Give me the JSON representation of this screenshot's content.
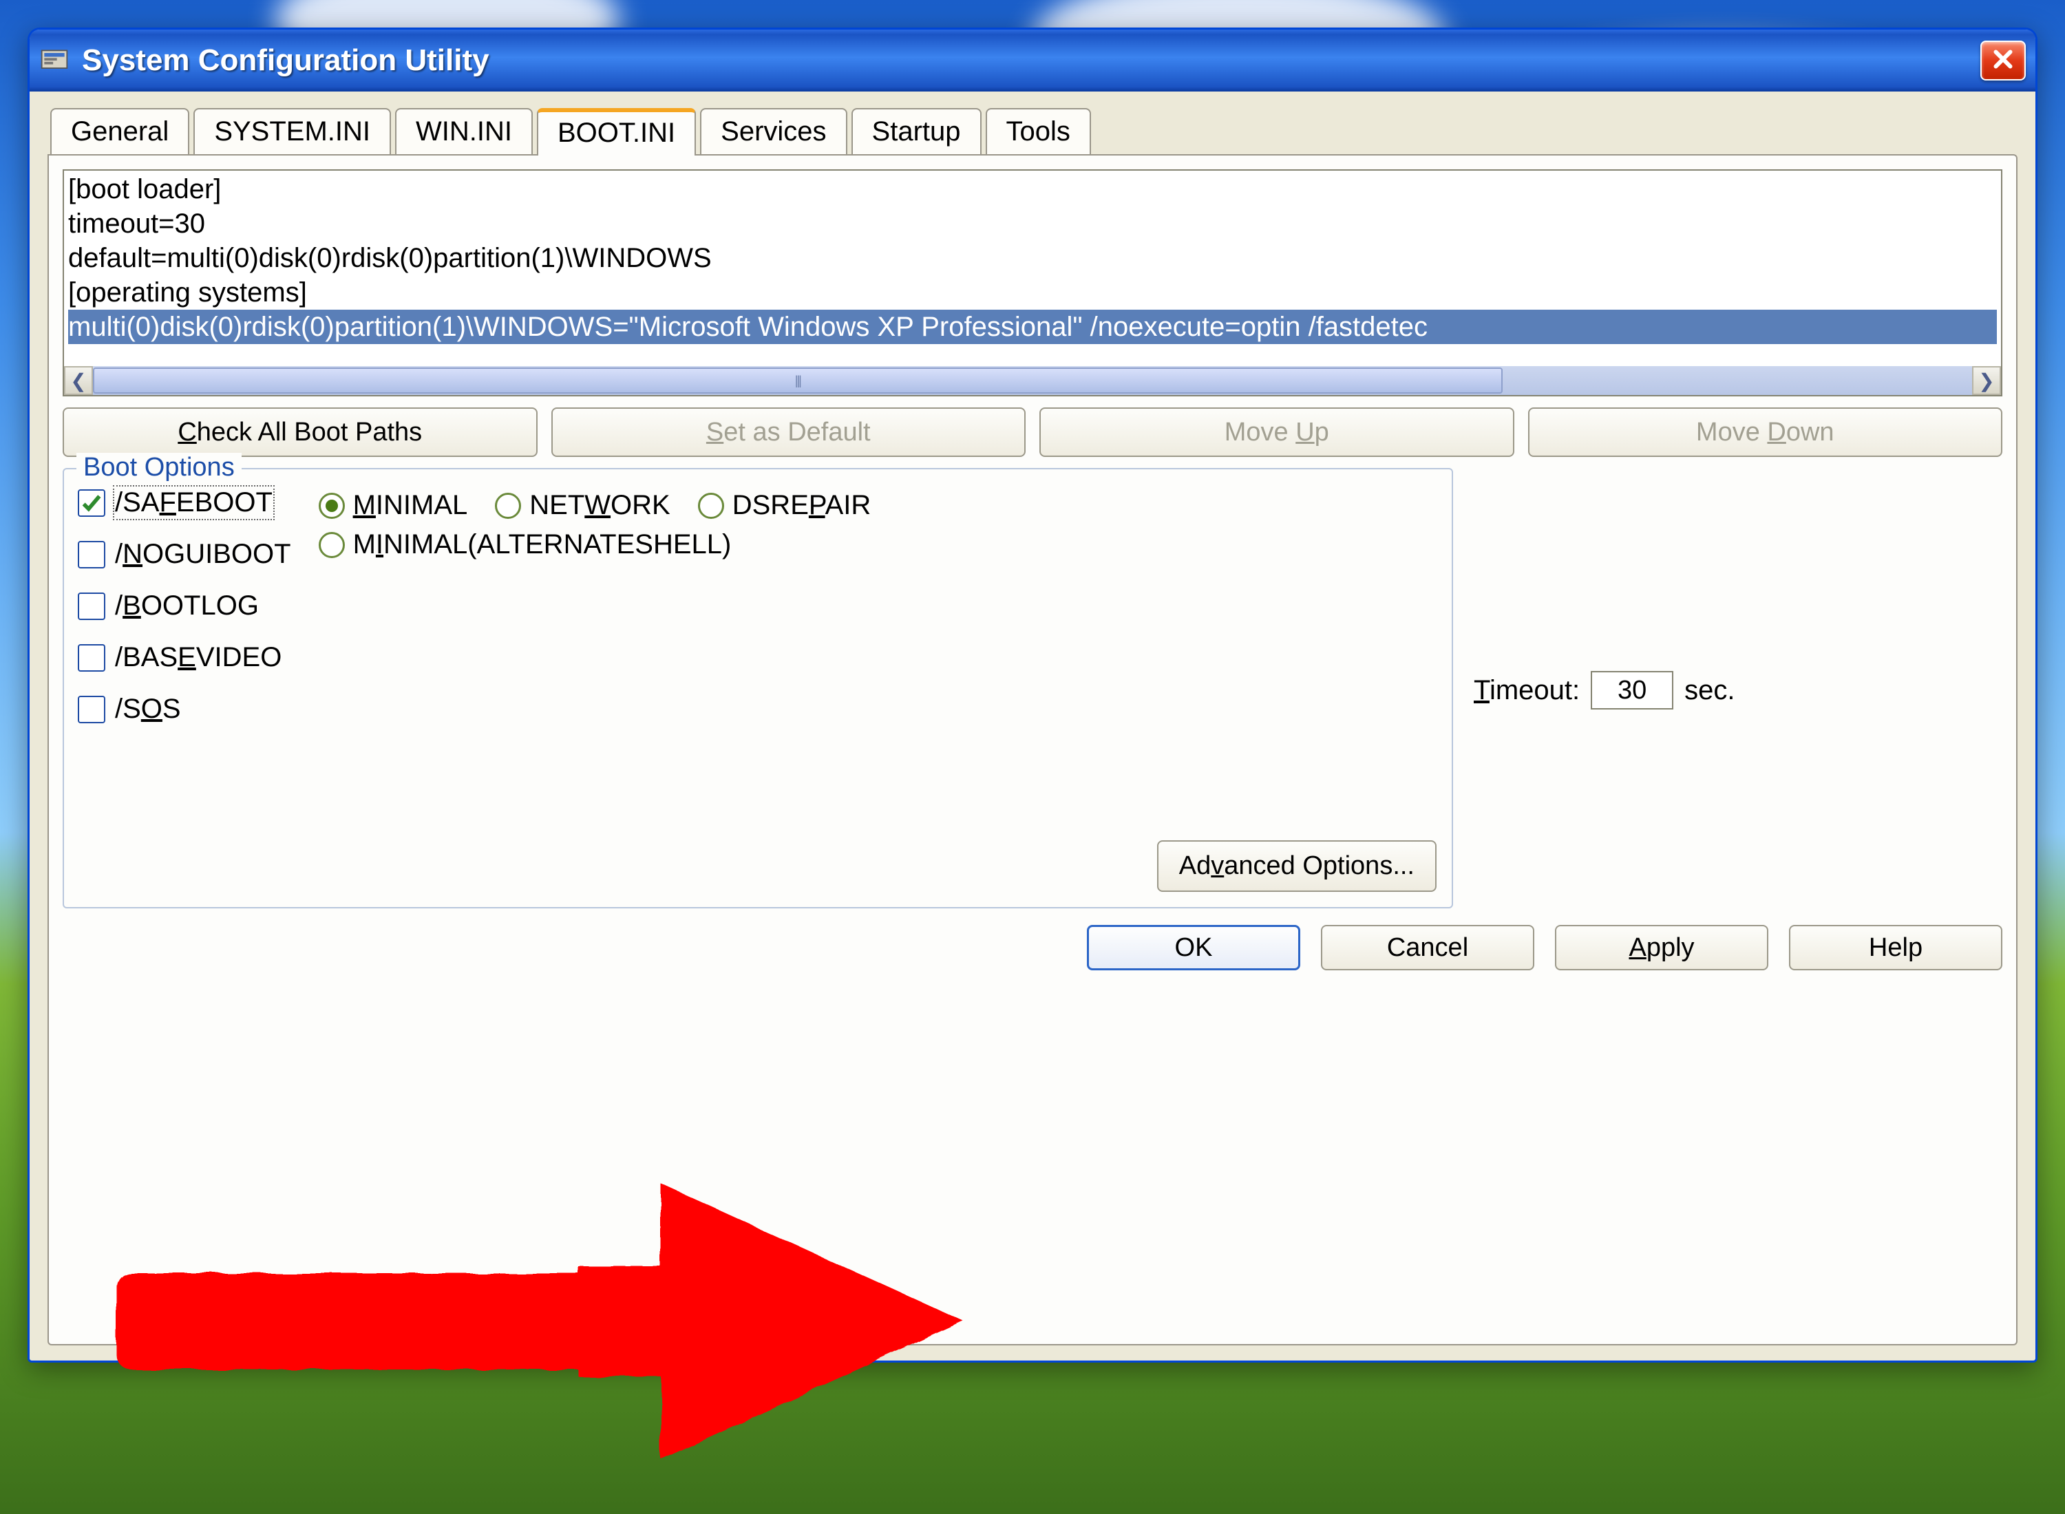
{
  "window": {
    "title": "System Configuration Utility"
  },
  "tabs": [
    {
      "label": "General"
    },
    {
      "label": "SYSTEM.INI"
    },
    {
      "label": "WIN.INI"
    },
    {
      "label": "BOOT.INI",
      "active": true
    },
    {
      "label": "Services"
    },
    {
      "label": "Startup"
    },
    {
      "label": "Tools"
    }
  ],
  "bootini": {
    "lines": [
      "[boot loader]",
      "timeout=30",
      "default=multi(0)disk(0)rdisk(0)partition(1)\\WINDOWS",
      "[operating systems]"
    ],
    "selected_line": "multi(0)disk(0)rdisk(0)partition(1)\\WINDOWS=\"Microsoft Windows XP Professional\" /noexecute=optin /fastdetec"
  },
  "buttons": {
    "check_paths": "Check All Boot Paths",
    "set_default": "Set as Default",
    "move_up": "Move Up",
    "move_down": "Move Down",
    "advanced": "Advanced Options..."
  },
  "boot_options": {
    "legend": "Boot Options",
    "checks": {
      "safeboot": {
        "label": "/SAFEBOOT",
        "ul": "F",
        "checked": true
      },
      "noguiboot": {
        "label": "/NOGUIBOOT",
        "ul": "N",
        "checked": false
      },
      "bootlog": {
        "label": "/BOOTLOG",
        "ul": "B",
        "checked": false
      },
      "basevideo": {
        "label": "/BASEVIDEO",
        "ul": "E",
        "checked": false
      },
      "sos": {
        "label": "/SOS",
        "ul": "O",
        "checked": false
      }
    },
    "radios": {
      "minimal": {
        "label": "MINIMAL",
        "ul": "M",
        "selected": true
      },
      "network": {
        "label": "NETWORK",
        "ul": "W",
        "selected": false
      },
      "dsrepair": {
        "label": "DSREPAIR",
        "ul": "P",
        "selected": false
      },
      "minalt": {
        "label": "MINIMAL(ALTERNATESHELL)",
        "ul": "I",
        "selected": false
      }
    }
  },
  "timeout": {
    "label": "Timeout:",
    "ul": "T",
    "value": "30",
    "suffix": "sec."
  },
  "dialog_buttons": {
    "ok": "OK",
    "cancel": "Cancel",
    "apply": "Apply",
    "help": "Help"
  }
}
